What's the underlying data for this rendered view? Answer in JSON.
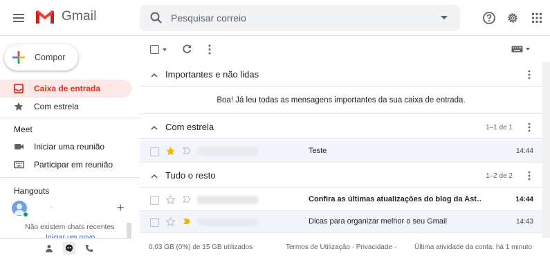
{
  "header": {
    "app_name": "Gmail",
    "search_placeholder": "Pesquisar correio"
  },
  "sidebar": {
    "compose_label": "Compor",
    "nav": [
      {
        "label": "Caixa de entrada",
        "icon": "inbox-icon",
        "active": true
      },
      {
        "label": "Com estrela",
        "icon": "star-icon",
        "active": false
      }
    ],
    "meet": {
      "title": "Meet",
      "items": [
        {
          "label": "Iniciar uma reunião",
          "icon": "video-icon"
        },
        {
          "label": "Participar em reunião",
          "icon": "keyboard-icon"
        }
      ]
    },
    "hangouts": {
      "title": "Hangouts",
      "user_name": "·",
      "no_chats": "Não existem chats recentes",
      "start_link": "Iniciar um novo"
    }
  },
  "sections": [
    {
      "title": "Importantes e não lidas",
      "count": "",
      "empty_message": "Boa! Já leu todas as mensagens importantes da sua caixa de entrada."
    },
    {
      "title": "Com estrela",
      "count": "1–1 de 1",
      "rows": [
        {
          "sender": "",
          "subject": "Teste",
          "time": "14:44",
          "starred": true,
          "important": false,
          "unread": false
        }
      ]
    },
    {
      "title": "Tudo o resto",
      "count": "1–2 de 2",
      "rows": [
        {
          "sender": "",
          "subject": "Confira as últimas atualizações do blog da Ast…",
          "time": "14:44",
          "starred": false,
          "important": false,
          "unread": true
        },
        {
          "sender": "",
          "subject": "Dicas para organizar melhor o seu Gmail",
          "time": "14:43",
          "starred": false,
          "important": true,
          "unread": false
        }
      ]
    }
  ],
  "footer": {
    "storage": "0,03 GB (0%) de 15 GB utilizados",
    "terms": "Termos de Utilização · Privacidade ·",
    "activity": "Última atividade da conta: há 1 minuto"
  },
  "colors": {
    "accent_red": "#d93025",
    "active_bg": "#fce8e6",
    "star_yellow": "#f4b400",
    "read_row_bg": "#f2f6fc"
  }
}
